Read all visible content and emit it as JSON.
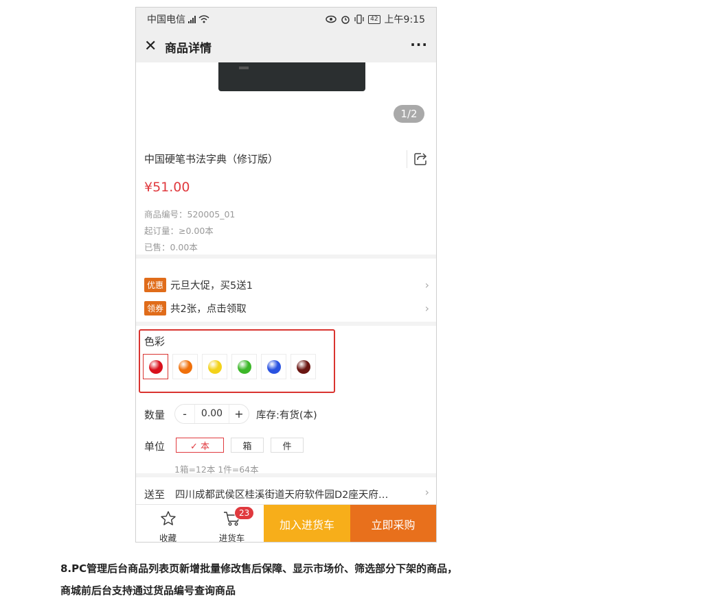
{
  "status_bar": {
    "carrier": "中国电信",
    "time": "上午9:15",
    "battery": "42",
    "network": "4G"
  },
  "nav": {
    "title": "商品详情",
    "close_icon": "close-icon",
    "more_icon": "more-icon"
  },
  "gallery": {
    "counter": "1/2"
  },
  "product": {
    "name": "中国硬笔书法字典（修订版）",
    "price": "¥51.00",
    "sku": "商品编号：520005_01",
    "min_order": "起订量：≥0.00本",
    "sold": "已售：0.00本"
  },
  "promotions": [
    {
      "tag": "优惠",
      "text": "元旦大促，买5送1"
    },
    {
      "tag": "领券",
      "text": "共2张，点击领取"
    }
  ],
  "color": {
    "label": "色彩",
    "swatches": [
      "#d9101c",
      "#f0700a",
      "#f3d21a",
      "#3cb728",
      "#2952e0",
      "#6a1612"
    ]
  },
  "quantity": {
    "label": "数量",
    "minus": "-",
    "value": "0.00",
    "plus": "+",
    "stock": "库存:有货(本)"
  },
  "unit": {
    "label": "单位",
    "options": [
      {
        "label": "✓ 本",
        "selected": true
      },
      {
        "label": "箱",
        "selected": false
      },
      {
        "label": "件",
        "selected": false
      }
    ],
    "conversion": "1箱=12本 1件=64本"
  },
  "shipping": {
    "label": "送至",
    "address": "四川成都武侯区桂溪街道天府软件园D2座天府…"
  },
  "bottom_bar": {
    "favorite_label": "收藏",
    "cart_label": "进货车",
    "cart_count": "23",
    "add_to_cart": "加入进货车",
    "buy_now": "立即采购"
  },
  "captions": {
    "line1": "8.PC管理后台商品列表页新增批量修改售后保障、显示市场价、筛选部分下架的商品，",
    "line2": "商城前后台支持通过货品编号查询商品"
  },
  "colors": {
    "price_red": "#e0393e",
    "tag_orange": "#e06c1a",
    "cart_yellow": "#f7ae1a",
    "buy_orange": "#e8701c",
    "highlight_red": "#d9332f"
  }
}
